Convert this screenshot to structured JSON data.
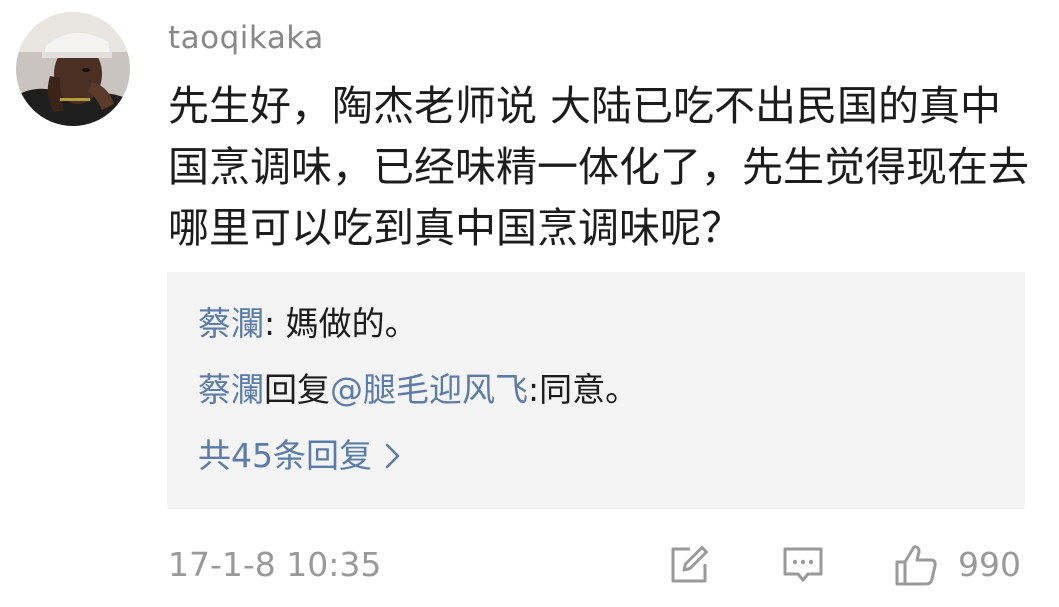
{
  "comment": {
    "author": "taoqikaka",
    "text": "先生好，陶杰老师说 大陆已吃不出民国的真中国烹调味，已经味精一体化了，先生觉得现在去哪里可以吃到真中国烹调味呢？",
    "timestamp": "17-1-8 10:35",
    "like_count": "990"
  },
  "replies": [
    {
      "author": "蔡瀾",
      "separator": ": ",
      "text": "媽做的。"
    },
    {
      "author": "蔡瀾",
      "action": "回复",
      "mention": "@腿毛迎风飞",
      "separator": ":",
      "text": "同意。"
    }
  ],
  "more_replies_label": "共45条回复",
  "colors": {
    "link_blue": "#5b7ca8",
    "muted_gray": "#999999",
    "text": "#1c1c1c",
    "reply_bg": "#f4f4f4"
  },
  "icons": [
    "edit-icon",
    "comment-icon",
    "thumbs-up-icon",
    "chevron-right-icon"
  ]
}
